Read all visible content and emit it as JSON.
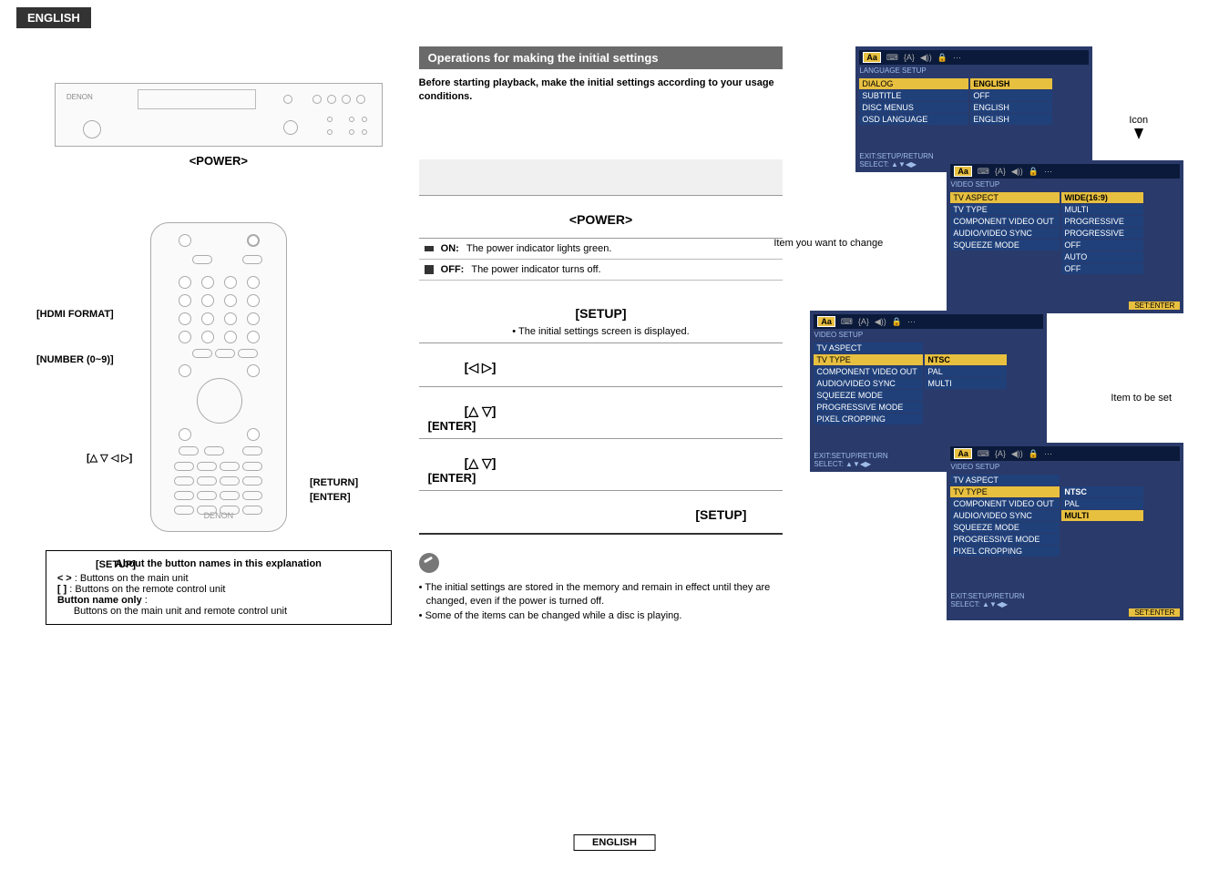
{
  "header": {
    "lang": "ENGLISH"
  },
  "device": {
    "brand": "DENON",
    "power_label": "<POWER>"
  },
  "remote": {
    "callouts": {
      "hdmi": "[HDMI FORMAT]",
      "number": "[NUMBER (0~9)]",
      "dpad": "[△ ▽ ◁ ▷]",
      "return": "[RETURN]",
      "enter": "[ENTER]",
      "setup": "[SETUP]"
    },
    "brand": "DENON"
  },
  "mid": {
    "section_title": "Operations for making the initial settings",
    "intro": "Before starting playback, make the initial settings according to your usage conditions.",
    "power_title": "<POWER>",
    "on_label": "ON:",
    "on_text": "The power indicator lights green.",
    "off_label": "OFF:",
    "off_text": "The power indicator turns off.",
    "setup_title": "[SETUP]",
    "setup_sub": "• The initial settings screen is displayed.",
    "lr_title": "[◁ ▷]",
    "ud_title": "[△ ▽]",
    "enter_label": "[ENTER]",
    "ud_title2": "[△ ▽]",
    "enter_label2": "[ENTER]",
    "setup_right": "[SETUP]",
    "note1": "The initial settings are stored in the memory and remain in effect until they are changed, even if the power is turned off.",
    "note2": "Some of the items can be changed while a disc is playing."
  },
  "right": {
    "icon_label": "Icon",
    "item_change_label": "Item you want to change",
    "item_set_label": "Item to be set",
    "osd1": {
      "title": "LANGUAGE SETUP",
      "rows": [
        {
          "k": "DIALOG",
          "v": "ENGLISH",
          "hl": true
        },
        {
          "k": "SUBTITLE",
          "v": "OFF"
        },
        {
          "k": "DISC MENUS",
          "v": "ENGLISH"
        },
        {
          "k": "OSD LANGUAGE",
          "v": "ENGLISH"
        }
      ],
      "footer": "EXIT:SETUP/RETURN\nSELECT: ▲▼◀▶"
    },
    "osd2": {
      "title": "VIDEO SETUP",
      "rows": [
        {
          "k": "TV ASPECT",
          "v": "WIDE(16:9)",
          "hl": true
        },
        {
          "k": "TV TYPE",
          "v": "MULTI"
        },
        {
          "k": "COMPONENT VIDEO OUT",
          "v": "PROGRESSIVE"
        },
        {
          "k": "AUDIO/VIDEO SYNC",
          "v": "PROGRESSIVE"
        },
        {
          "k": "SQUEEZE MODE",
          "v": "OFF"
        },
        {
          "k": "",
          "v": "AUTO"
        },
        {
          "k": "",
          "v": "OFF"
        }
      ],
      "footer_set": "SET:ENTER"
    },
    "osd3": {
      "title": "VIDEO SETUP",
      "rows": [
        {
          "k": "TV ASPECT",
          "v": ""
        },
        {
          "k": "TV TYPE",
          "v": "NTSC",
          "hl": true,
          "vhl": true
        },
        {
          "k": "COMPONENT VIDEO OUT",
          "v": "PAL"
        },
        {
          "k": "AUDIO/VIDEO SYNC",
          "v": "MULTI"
        },
        {
          "k": "SQUEEZE MODE",
          "v": ""
        },
        {
          "k": "PROGRESSIVE MODE",
          "v": ""
        },
        {
          "k": "PIXEL CROPPING",
          "v": ""
        }
      ],
      "footer": "EXIT:SETUP/RETURN\nSELECT: ▲▼◀▶"
    },
    "osd4": {
      "title": "VIDEO SETUP",
      "rows": [
        {
          "k": "TV ASPECT",
          "v": ""
        },
        {
          "k": "TV TYPE",
          "v": "NTSC",
          "hl": true
        },
        {
          "k": "COMPONENT VIDEO OUT",
          "v": "PAL"
        },
        {
          "k": "AUDIO/VIDEO SYNC",
          "v": "MULTI",
          "vhl": true
        },
        {
          "k": "SQUEEZE MODE",
          "v": ""
        },
        {
          "k": "PROGRESSIVE MODE",
          "v": ""
        },
        {
          "k": "PIXEL CROPPING",
          "v": ""
        }
      ],
      "footer": "EXIT:SETUP/RETURN\nSELECT: ▲▼◀▶",
      "footer_set": "SET:ENTER"
    },
    "tabs": "Aa  ⌨  {A}  ◀))  🔒  ⋯"
  },
  "about": {
    "title": "About the button names in this explanation",
    "row1_sym": "<    >",
    "row1_text": ": Buttons on the main unit",
    "row2_sym": "[    ]",
    "row2_text": ": Buttons on the remote control unit",
    "row3_label": "Button name only",
    "row3_text": "Buttons on the main unit and remote control unit"
  },
  "footer": {
    "lang": "ENGLISH"
  }
}
